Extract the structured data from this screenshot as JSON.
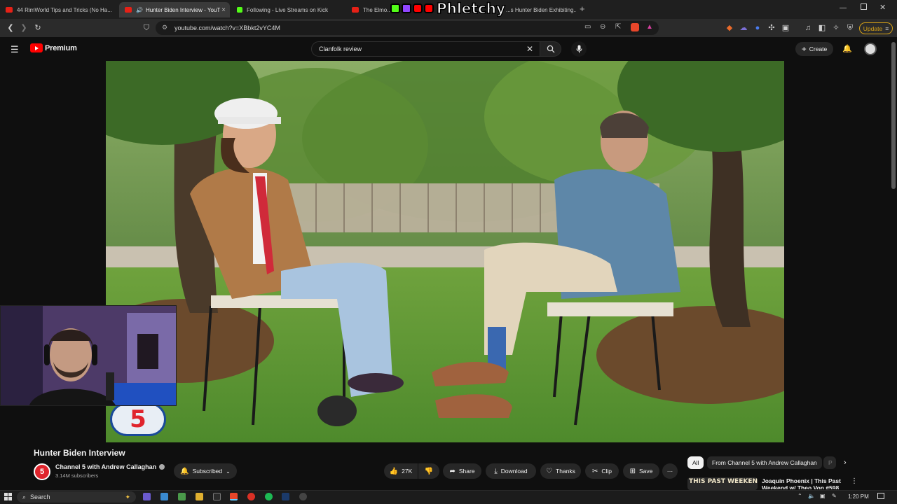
{
  "browser": {
    "tabs": [
      {
        "title": "44 RimWorld Tips and Tricks (No Ha..."
      },
      {
        "title": "Hunter Biden Interview - YouT",
        "close": "×"
      },
      {
        "title": "Following - Live Streams on Kick"
      },
      {
        "title": "The Elmo..."
      },
      {
        "title": "...s Hunter Biden Exhibiting..."
      }
    ],
    "new_tab": "+",
    "url": "youtube.com/watch?v=XBbkt2vYC4M",
    "update_label": "Update",
    "overlay_logo_text": "Phletchy"
  },
  "youtube": {
    "brand": "Premium",
    "search_value": "Clanfolk review",
    "create_label": "Create",
    "video": {
      "title": "Hunter Biden Interview"
    },
    "channel": {
      "name": "Channel 5 with Andrew Callaghan",
      "subscribers": "3.14M subscribers",
      "subscribed_label": "Subscribed"
    },
    "actions": {
      "like_count": "27K",
      "share": "Share",
      "download": "Download",
      "thanks": "Thanks",
      "clip": "Clip",
      "save": "Save",
      "more": "···"
    },
    "chips": [
      {
        "label": "All"
      },
      {
        "label": "From Channel 5 with Andrew Callaghan"
      },
      {
        "label": "P"
      }
    ],
    "recommendation": {
      "title_line1": "Joaquin Phoenix | This Past",
      "title_line2": "Weekend w/ Theo Von #598",
      "thumb_text": "THIS PAST WEEKEND"
    }
  },
  "taskbar": {
    "search_label": "Search",
    "time": "1:20 PM"
  },
  "colors": {
    "yt_red": "#ff0000",
    "bg": "#0f0f0f",
    "pill": "#272727",
    "update_border": "#d4a017"
  }
}
